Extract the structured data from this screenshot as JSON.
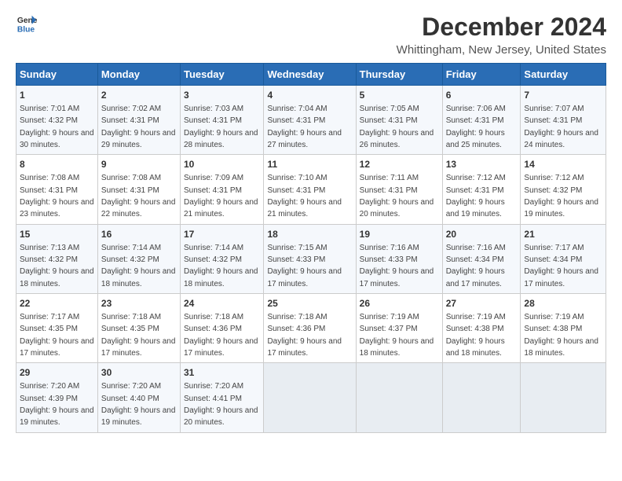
{
  "logo": {
    "line1": "General",
    "line2": "Blue"
  },
  "title": "December 2024",
  "subtitle": "Whittingham, New Jersey, United States",
  "days_header": [
    "Sunday",
    "Monday",
    "Tuesday",
    "Wednesday",
    "Thursday",
    "Friday",
    "Saturday"
  ],
  "weeks": [
    [
      {
        "day": "1",
        "sunrise": "7:01 AM",
        "sunset": "4:32 PM",
        "daylight": "9 hours and 30 minutes."
      },
      {
        "day": "2",
        "sunrise": "7:02 AM",
        "sunset": "4:31 PM",
        "daylight": "9 hours and 29 minutes."
      },
      {
        "day": "3",
        "sunrise": "7:03 AM",
        "sunset": "4:31 PM",
        "daylight": "9 hours and 28 minutes."
      },
      {
        "day": "4",
        "sunrise": "7:04 AM",
        "sunset": "4:31 PM",
        "daylight": "9 hours and 27 minutes."
      },
      {
        "day": "5",
        "sunrise": "7:05 AM",
        "sunset": "4:31 PM",
        "daylight": "9 hours and 26 minutes."
      },
      {
        "day": "6",
        "sunrise": "7:06 AM",
        "sunset": "4:31 PM",
        "daylight": "9 hours and 25 minutes."
      },
      {
        "day": "7",
        "sunrise": "7:07 AM",
        "sunset": "4:31 PM",
        "daylight": "9 hours and 24 minutes."
      }
    ],
    [
      {
        "day": "8",
        "sunrise": "7:08 AM",
        "sunset": "4:31 PM",
        "daylight": "9 hours and 23 minutes."
      },
      {
        "day": "9",
        "sunrise": "7:08 AM",
        "sunset": "4:31 PM",
        "daylight": "9 hours and 22 minutes."
      },
      {
        "day": "10",
        "sunrise": "7:09 AM",
        "sunset": "4:31 PM",
        "daylight": "9 hours and 21 minutes."
      },
      {
        "day": "11",
        "sunrise": "7:10 AM",
        "sunset": "4:31 PM",
        "daylight": "9 hours and 21 minutes."
      },
      {
        "day": "12",
        "sunrise": "7:11 AM",
        "sunset": "4:31 PM",
        "daylight": "9 hours and 20 minutes."
      },
      {
        "day": "13",
        "sunrise": "7:12 AM",
        "sunset": "4:31 PM",
        "daylight": "9 hours and 19 minutes."
      },
      {
        "day": "14",
        "sunrise": "7:12 AM",
        "sunset": "4:32 PM",
        "daylight": "9 hours and 19 minutes."
      }
    ],
    [
      {
        "day": "15",
        "sunrise": "7:13 AM",
        "sunset": "4:32 PM",
        "daylight": "9 hours and 18 minutes."
      },
      {
        "day": "16",
        "sunrise": "7:14 AM",
        "sunset": "4:32 PM",
        "daylight": "9 hours and 18 minutes."
      },
      {
        "day": "17",
        "sunrise": "7:14 AM",
        "sunset": "4:32 PM",
        "daylight": "9 hours and 18 minutes."
      },
      {
        "day": "18",
        "sunrise": "7:15 AM",
        "sunset": "4:33 PM",
        "daylight": "9 hours and 17 minutes."
      },
      {
        "day": "19",
        "sunrise": "7:16 AM",
        "sunset": "4:33 PM",
        "daylight": "9 hours and 17 minutes."
      },
      {
        "day": "20",
        "sunrise": "7:16 AM",
        "sunset": "4:34 PM",
        "daylight": "9 hours and 17 minutes."
      },
      {
        "day": "21",
        "sunrise": "7:17 AM",
        "sunset": "4:34 PM",
        "daylight": "9 hours and 17 minutes."
      }
    ],
    [
      {
        "day": "22",
        "sunrise": "7:17 AM",
        "sunset": "4:35 PM",
        "daylight": "9 hours and 17 minutes."
      },
      {
        "day": "23",
        "sunrise": "7:18 AM",
        "sunset": "4:35 PM",
        "daylight": "9 hours and 17 minutes."
      },
      {
        "day": "24",
        "sunrise": "7:18 AM",
        "sunset": "4:36 PM",
        "daylight": "9 hours and 17 minutes."
      },
      {
        "day": "25",
        "sunrise": "7:18 AM",
        "sunset": "4:36 PM",
        "daylight": "9 hours and 17 minutes."
      },
      {
        "day": "26",
        "sunrise": "7:19 AM",
        "sunset": "4:37 PM",
        "daylight": "9 hours and 18 minutes."
      },
      {
        "day": "27",
        "sunrise": "7:19 AM",
        "sunset": "4:38 PM",
        "daylight": "9 hours and 18 minutes."
      },
      {
        "day": "28",
        "sunrise": "7:19 AM",
        "sunset": "4:38 PM",
        "daylight": "9 hours and 18 minutes."
      }
    ],
    [
      {
        "day": "29",
        "sunrise": "7:20 AM",
        "sunset": "4:39 PM",
        "daylight": "9 hours and 19 minutes."
      },
      {
        "day": "30",
        "sunrise": "7:20 AM",
        "sunset": "4:40 PM",
        "daylight": "9 hours and 19 minutes."
      },
      {
        "day": "31",
        "sunrise": "7:20 AM",
        "sunset": "4:41 PM",
        "daylight": "9 hours and 20 minutes."
      },
      null,
      null,
      null,
      null
    ]
  ]
}
